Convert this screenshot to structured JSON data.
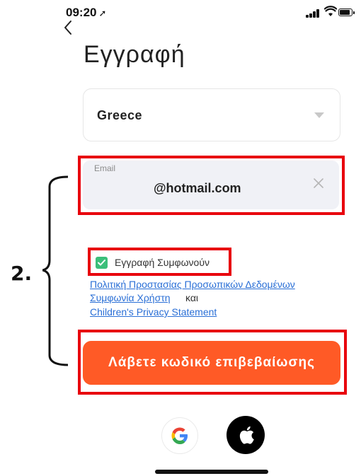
{
  "status_bar": {
    "time": "09:20",
    "location_arrow": "➚"
  },
  "header": {
    "back_icon": "chevron-left-icon",
    "title": "Εγγραφή"
  },
  "country": {
    "value": "Greece",
    "caret_icon": "caret-down-icon"
  },
  "email": {
    "label": "Email",
    "value": "@hotmail.com",
    "clear_icon": "close-icon"
  },
  "agreement": {
    "checked": true,
    "label": "Εγγραφή Συμφωνούν",
    "privacy_link": "Πολιτική Προστασίας Προσωπικών Δεδομένων",
    "terms_link": "Συμφωνία Χρήστη",
    "and_text": "και",
    "children_link": "Children's Privacy Statement"
  },
  "submit": {
    "label": "Λάβετε κωδικό επιβεβαίωσης"
  },
  "annotation": {
    "step_label": "2."
  },
  "social": {
    "google_icon": "google-icon",
    "apple_icon": "apple-icon"
  },
  "colors": {
    "accent": "#ff5a26",
    "highlight": "#e8000c",
    "check": "#3bbf7a",
    "link": "#2a6fd6"
  }
}
